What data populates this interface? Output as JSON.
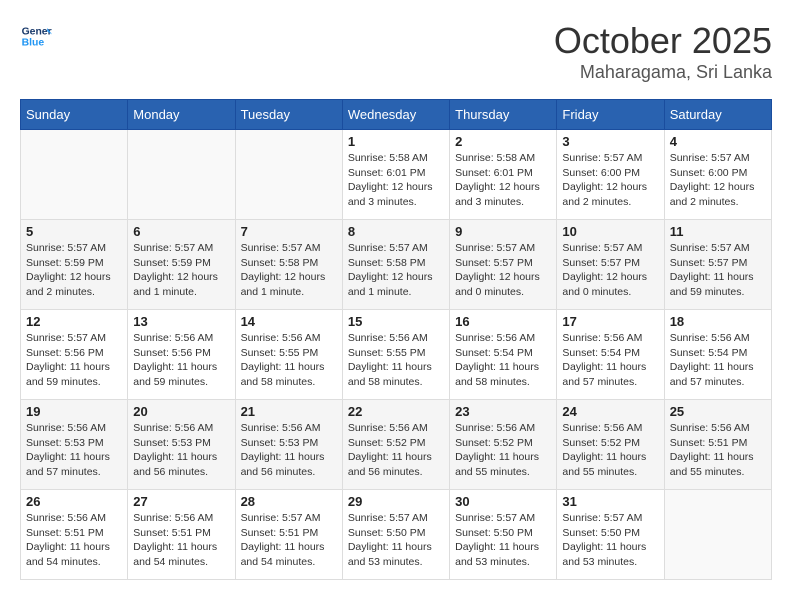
{
  "header": {
    "logo_line1": "General",
    "logo_line2": "Blue",
    "month": "October 2025",
    "location": "Maharagama, Sri Lanka"
  },
  "days_of_week": [
    "Sunday",
    "Monday",
    "Tuesday",
    "Wednesday",
    "Thursday",
    "Friday",
    "Saturday"
  ],
  "weeks": [
    [
      {
        "day": "",
        "info": ""
      },
      {
        "day": "",
        "info": ""
      },
      {
        "day": "",
        "info": ""
      },
      {
        "day": "1",
        "info": "Sunrise: 5:58 AM\nSunset: 6:01 PM\nDaylight: 12 hours\nand 3 minutes."
      },
      {
        "day": "2",
        "info": "Sunrise: 5:58 AM\nSunset: 6:01 PM\nDaylight: 12 hours\nand 3 minutes."
      },
      {
        "day": "3",
        "info": "Sunrise: 5:57 AM\nSunset: 6:00 PM\nDaylight: 12 hours\nand 2 minutes."
      },
      {
        "day": "4",
        "info": "Sunrise: 5:57 AM\nSunset: 6:00 PM\nDaylight: 12 hours\nand 2 minutes."
      }
    ],
    [
      {
        "day": "5",
        "info": "Sunrise: 5:57 AM\nSunset: 5:59 PM\nDaylight: 12 hours\nand 2 minutes."
      },
      {
        "day": "6",
        "info": "Sunrise: 5:57 AM\nSunset: 5:59 PM\nDaylight: 12 hours\nand 1 minute."
      },
      {
        "day": "7",
        "info": "Sunrise: 5:57 AM\nSunset: 5:58 PM\nDaylight: 12 hours\nand 1 minute."
      },
      {
        "day": "8",
        "info": "Sunrise: 5:57 AM\nSunset: 5:58 PM\nDaylight: 12 hours\nand 1 minute."
      },
      {
        "day": "9",
        "info": "Sunrise: 5:57 AM\nSunset: 5:57 PM\nDaylight: 12 hours\nand 0 minutes."
      },
      {
        "day": "10",
        "info": "Sunrise: 5:57 AM\nSunset: 5:57 PM\nDaylight: 12 hours\nand 0 minutes."
      },
      {
        "day": "11",
        "info": "Sunrise: 5:57 AM\nSunset: 5:57 PM\nDaylight: 11 hours\nand 59 minutes."
      }
    ],
    [
      {
        "day": "12",
        "info": "Sunrise: 5:57 AM\nSunset: 5:56 PM\nDaylight: 11 hours\nand 59 minutes."
      },
      {
        "day": "13",
        "info": "Sunrise: 5:56 AM\nSunset: 5:56 PM\nDaylight: 11 hours\nand 59 minutes."
      },
      {
        "day": "14",
        "info": "Sunrise: 5:56 AM\nSunset: 5:55 PM\nDaylight: 11 hours\nand 58 minutes."
      },
      {
        "day": "15",
        "info": "Sunrise: 5:56 AM\nSunset: 5:55 PM\nDaylight: 11 hours\nand 58 minutes."
      },
      {
        "day": "16",
        "info": "Sunrise: 5:56 AM\nSunset: 5:54 PM\nDaylight: 11 hours\nand 58 minutes."
      },
      {
        "day": "17",
        "info": "Sunrise: 5:56 AM\nSunset: 5:54 PM\nDaylight: 11 hours\nand 57 minutes."
      },
      {
        "day": "18",
        "info": "Sunrise: 5:56 AM\nSunset: 5:54 PM\nDaylight: 11 hours\nand 57 minutes."
      }
    ],
    [
      {
        "day": "19",
        "info": "Sunrise: 5:56 AM\nSunset: 5:53 PM\nDaylight: 11 hours\nand 57 minutes."
      },
      {
        "day": "20",
        "info": "Sunrise: 5:56 AM\nSunset: 5:53 PM\nDaylight: 11 hours\nand 56 minutes."
      },
      {
        "day": "21",
        "info": "Sunrise: 5:56 AM\nSunset: 5:53 PM\nDaylight: 11 hours\nand 56 minutes."
      },
      {
        "day": "22",
        "info": "Sunrise: 5:56 AM\nSunset: 5:52 PM\nDaylight: 11 hours\nand 56 minutes."
      },
      {
        "day": "23",
        "info": "Sunrise: 5:56 AM\nSunset: 5:52 PM\nDaylight: 11 hours\nand 55 minutes."
      },
      {
        "day": "24",
        "info": "Sunrise: 5:56 AM\nSunset: 5:52 PM\nDaylight: 11 hours\nand 55 minutes."
      },
      {
        "day": "25",
        "info": "Sunrise: 5:56 AM\nSunset: 5:51 PM\nDaylight: 11 hours\nand 55 minutes."
      }
    ],
    [
      {
        "day": "26",
        "info": "Sunrise: 5:56 AM\nSunset: 5:51 PM\nDaylight: 11 hours\nand 54 minutes."
      },
      {
        "day": "27",
        "info": "Sunrise: 5:56 AM\nSunset: 5:51 PM\nDaylight: 11 hours\nand 54 minutes."
      },
      {
        "day": "28",
        "info": "Sunrise: 5:57 AM\nSunset: 5:51 PM\nDaylight: 11 hours\nand 54 minutes."
      },
      {
        "day": "29",
        "info": "Sunrise: 5:57 AM\nSunset: 5:50 PM\nDaylight: 11 hours\nand 53 minutes."
      },
      {
        "day": "30",
        "info": "Sunrise: 5:57 AM\nSunset: 5:50 PM\nDaylight: 11 hours\nand 53 minutes."
      },
      {
        "day": "31",
        "info": "Sunrise: 5:57 AM\nSunset: 5:50 PM\nDaylight: 11 hours\nand 53 minutes."
      },
      {
        "day": "",
        "info": ""
      }
    ]
  ]
}
